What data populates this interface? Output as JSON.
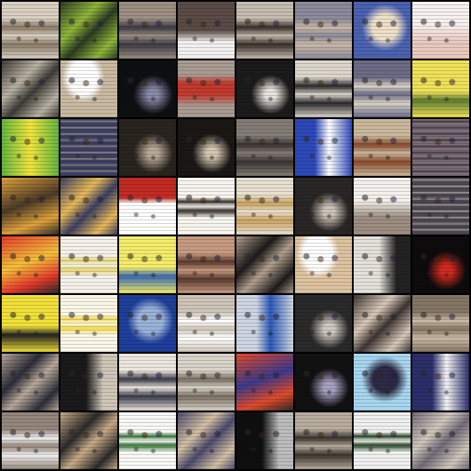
{
  "grid": {
    "rows": 8,
    "cols": 8,
    "tiles": [
      {
        "base": "#d8cfc0",
        "accent": "#8a7a68",
        "style": "doc"
      },
      {
        "base": "#2b3a22",
        "accent": "#8fb63a",
        "style": "busy"
      },
      {
        "base": "#9c8f82",
        "accent": "#3c3a44",
        "style": "doc"
      },
      {
        "base": "#5a4b46",
        "accent": "#f2f0ee",
        "style": "bright-bottom"
      },
      {
        "base": "#c5bcb0",
        "accent": "#3b2f2a",
        "style": "doc"
      },
      {
        "base": "#8c8a9a",
        "accent": "#c8b9a6",
        "style": "doc"
      },
      {
        "base": "#4a62b0",
        "accent": "#efe0c8",
        "style": "blue-center"
      },
      {
        "base": "#e9c9bf",
        "accent": "#f6f1ef",
        "style": "bright-top"
      },
      {
        "base": "#3d3b36",
        "accent": "#b9b2a3",
        "style": "busy"
      },
      {
        "base": "#c9b9a0",
        "accent": "#ffffff",
        "style": "white-blob"
      },
      {
        "base": "#0e0f12",
        "accent": "#8a88a8",
        "style": "dark"
      },
      {
        "base": "#a89c92",
        "accent": "#c2392c",
        "style": "red-band"
      },
      {
        "base": "#1b1b1b",
        "accent": "#e8e2dc",
        "style": "dark"
      },
      {
        "base": "#dcd6cc",
        "accent": "#2a2a2a",
        "style": "doc"
      },
      {
        "base": "#6b6b86",
        "accent": "#d8d2c6",
        "style": "doc"
      },
      {
        "base": "#efe15a",
        "accent": "#5c7b30",
        "style": "yellow"
      },
      {
        "base": "#62b540",
        "accent": "#f2e43c",
        "style": "green-yellow"
      },
      {
        "base": "#3b3f62",
        "accent": "#9a8f88",
        "style": "stripes"
      },
      {
        "base": "#2a241f",
        "accent": "#b8a894",
        "style": "dark"
      },
      {
        "base": "#1a1714",
        "accent": "#d4c6b0",
        "style": "dark"
      },
      {
        "base": "#857c76",
        "accent": "#3a3432",
        "style": "doc"
      },
      {
        "base": "#2d49b8",
        "accent": "#ffffff",
        "style": "blue-white"
      },
      {
        "base": "#c9b89c",
        "accent": "#8a4a2e",
        "style": "doc"
      },
      {
        "base": "#7a6d79",
        "accent": "#3a3036",
        "style": "stripes"
      },
      {
        "base": "#e0a23a",
        "accent": "#4a3a28",
        "style": "orange"
      },
      {
        "base": "#3d3f62",
        "accent": "#e6b85a",
        "style": "busy"
      },
      {
        "base": "#c22b22",
        "accent": "#ffffff",
        "style": "red-white"
      },
      {
        "base": "#f7f4ef",
        "accent": "#3b332c",
        "style": "white-doc"
      },
      {
        "base": "#e8e0cf",
        "accent": "#c9a160",
        "style": "doc"
      },
      {
        "base": "#2a2626",
        "accent": "#ccc3b6",
        "style": "dark"
      },
      {
        "base": "#9c8d80",
        "accent": "#f4f0ec",
        "style": "bright-top"
      },
      {
        "base": "#4a4752",
        "accent": "#b3a79b",
        "style": "stripes"
      },
      {
        "base": "#e2392a",
        "accent": "#f2c13a",
        "style": "orange"
      },
      {
        "base": "#f5f1ea",
        "accent": "#e8d870",
        "style": "white-doc"
      },
      {
        "base": "#f4ec6a",
        "accent": "#3a6ab4",
        "style": "yellow"
      },
      {
        "base": "#c69a80",
        "accent": "#5a3a2e",
        "style": "doc"
      },
      {
        "base": "#b2a08e",
        "accent": "#1c1a1a",
        "style": "busy"
      },
      {
        "base": "#ddc2a0",
        "accent": "#ffffff",
        "style": "white-blob"
      },
      {
        "base": "#e4e0da",
        "accent": "#222222",
        "style": "dark-left"
      },
      {
        "base": "#0d0b0b",
        "accent": "#d32a1e",
        "style": "dark"
      },
      {
        "base": "#f1e03a",
        "accent": "#222222",
        "style": "yellow"
      },
      {
        "base": "#fbf7e8",
        "accent": "#f3dc4a",
        "style": "white-doc"
      },
      {
        "base": "#1f3f9a",
        "accent": "#9ab2d8",
        "style": "blue-center"
      },
      {
        "base": "#cdc5b8",
        "accent": "#ffffff",
        "style": "doc"
      },
      {
        "base": "#cdd6e2",
        "accent": "#2c58b8",
        "style": "blue-white"
      },
      {
        "base": "#2a2a2a",
        "accent": "#cfc9c2",
        "style": "dark"
      },
      {
        "base": "#3d3532",
        "accent": "#d8c8b8",
        "style": "busy"
      },
      {
        "base": "#847665",
        "accent": "#cbbba6",
        "style": "doc"
      },
      {
        "base": "#b8a89a",
        "accent": "#2b2c38",
        "style": "busy"
      },
      {
        "base": "#1a1a1a",
        "accent": "#d0c6b8",
        "style": "dark-left"
      },
      {
        "base": "#ece6df",
        "accent": "#3b3b4a",
        "style": "doc"
      },
      {
        "base": "#d9d3c8",
        "accent": "#7a6f62",
        "style": "doc"
      },
      {
        "base": "#e04a2a",
        "accent": "#3c3a8a",
        "style": "orange"
      },
      {
        "base": "#111111",
        "accent": "#a7a0c2",
        "style": "dark"
      },
      {
        "base": "#a7d6ef",
        "accent": "#2c2a44",
        "style": "blue-center"
      },
      {
        "base": "#2c2e6a",
        "accent": "#f3f3f3",
        "style": "blue-white"
      },
      {
        "base": "#93867a",
        "accent": "#eeeeee",
        "style": "doc"
      },
      {
        "base": "#c8ab86",
        "accent": "#2a2a2a",
        "style": "busy"
      },
      {
        "base": "#f8f8f5",
        "accent": "#3a7a3a",
        "style": "white-doc"
      },
      {
        "base": "#4c4a6c",
        "accent": "#d4c0a4",
        "style": "busy"
      },
      {
        "base": "#0f0f0f",
        "accent": "#bcbcbc",
        "style": "dark-left"
      },
      {
        "base": "#b8ac9e",
        "accent": "#3b342e",
        "style": "doc"
      },
      {
        "base": "#efefef",
        "accent": "#2a4a2a",
        "style": "white-doc"
      },
      {
        "base": "#726a78",
        "accent": "#cfc7bb",
        "style": "busy"
      }
    ]
  }
}
